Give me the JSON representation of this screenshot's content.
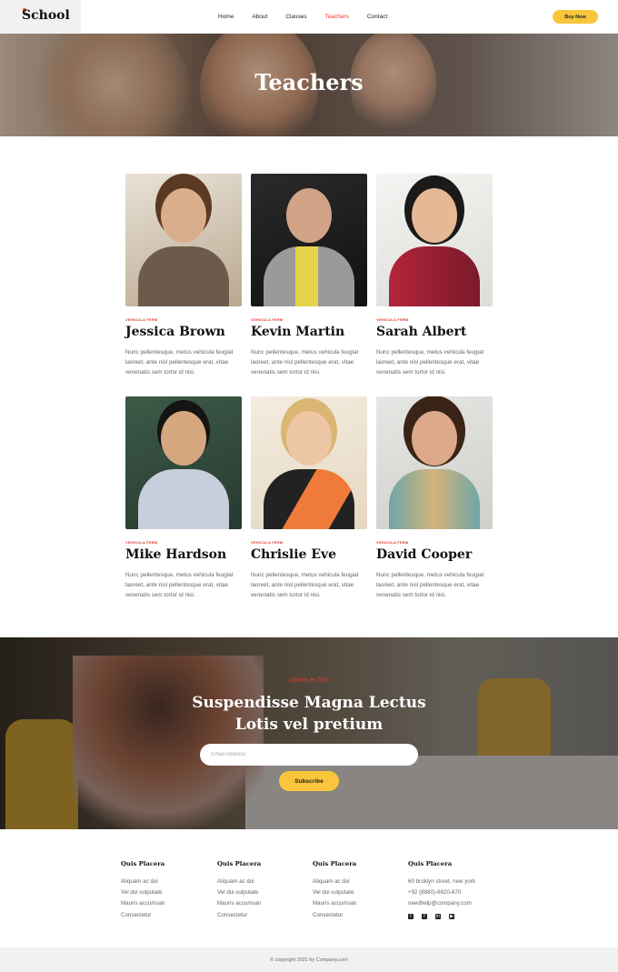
{
  "header": {
    "logo": "School",
    "nav": [
      "Home",
      "About",
      "Classes",
      "Teachers",
      "Contact"
    ],
    "active_nav": "Teachers",
    "buy_label": "Buy Now"
  },
  "hero": {
    "title": "Teachers"
  },
  "teachers": [
    {
      "role": "VEHICULA FERM",
      "name": "Jessica Brown",
      "desc": "Nunc pellentesque, metus vehicula feugiat laoreet, ante nisl pellentesque erat, vitae venenatis sem tortor id nisi."
    },
    {
      "role": "VEHICULA FERM",
      "name": "Kevin Martin",
      "desc": "Nunc pellentesque, metus vehicula feugiat laoreet, ante nisl pellentesque erat, vitae venenatis sem tortor id nisi."
    },
    {
      "role": "VEHICULA FERM",
      "name": "Sarah Albert",
      "desc": "Nunc pellentesque, metus vehicula feugiat laoreet, ante nisl pellentesque erat, vitae venenatis sem tortor id nisi."
    },
    {
      "role": "VEHICULA FERM",
      "name": "Mike Hardson",
      "desc": "Nunc pellentesque, metus vehicula feugiat laoreet, ante nisl pellentesque erat, vitae venenatis sem tortor id nisi."
    },
    {
      "role": "VEHICULA FERM",
      "name": "Chrislie Eve",
      "desc": "Nunc pellentesque, metus vehicula feugiat laoreet, ante nisl pellentesque erat, vitae venenatis sem tortor id nisi."
    },
    {
      "role": "VEHICULA FERM",
      "name": "David Cooper",
      "desc": "Nunc pellentesque, metus vehicula feugiat laoreet, ante nisl pellentesque erat, vitae venenatis sem tortor id nisi."
    }
  ],
  "subscribe": {
    "kicker": "Lbortis et Tolo",
    "title_line1": "Suspendisse Magna Lectus",
    "title_line2": "Lotis vel pretium",
    "email_placeholder": "Email Address",
    "button": "Subscribe"
  },
  "footer": {
    "columns": [
      {
        "heading": "Quis Placera",
        "links": [
          "Aliquam ac dui",
          "Vel dui vulputate",
          "Mauris accumsan",
          "Consectetur"
        ]
      },
      {
        "heading": "Quis Placera",
        "links": [
          "Aliquam ac dui",
          "Vel dui vulputate",
          "Mauris accumsan",
          "Consectetur"
        ]
      },
      {
        "heading": "Quis Placera",
        "links": [
          "Aliquam ac dui",
          "Vel dui vulputate",
          "Mauris accumsan",
          "Consectetur"
        ]
      },
      {
        "heading": "Quis Placera",
        "links": [
          "60 broklyn street, new york",
          "+92 (8860)-6620-870",
          "needhelp@company.com"
        ]
      }
    ],
    "social_icons": [
      "twitter-icon",
      "facebook-icon",
      "linkedin-icon",
      "youtube-icon"
    ],
    "copyright": "© copyright 2021 by Company.com"
  },
  "colors": {
    "accent_red": "#e23b2e",
    "button_yellow": "#f9c53a"
  }
}
